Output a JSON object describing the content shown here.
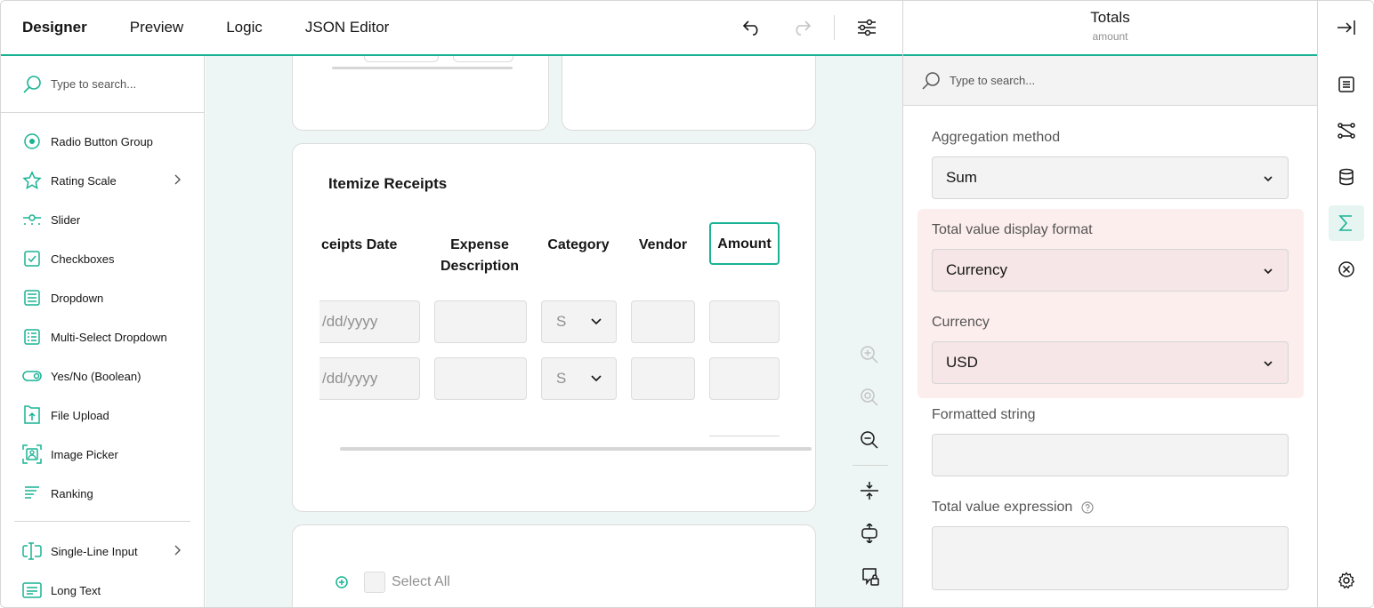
{
  "tabs": [
    "Designer",
    "Preview",
    "Logic",
    "JSON Editor"
  ],
  "toolbox": {
    "search_placeholder": "Type to search...",
    "items": [
      {
        "label": "Radio Button Group",
        "icon": "radio-icon"
      },
      {
        "label": "Rating Scale",
        "icon": "star-icon",
        "has_submenu": true
      },
      {
        "label": "Slider",
        "icon": "slider-icon"
      },
      {
        "label": "Checkboxes",
        "icon": "checkbox-icon"
      },
      {
        "label": "Dropdown",
        "icon": "dropdown-icon"
      },
      {
        "label": "Multi-Select Dropdown",
        "icon": "multiselect-icon"
      },
      {
        "label": "Yes/No (Boolean)",
        "icon": "toggle-icon"
      },
      {
        "label": "File Upload",
        "icon": "file-upload-icon"
      },
      {
        "label": "Image Picker",
        "icon": "image-picker-icon"
      },
      {
        "label": "Ranking",
        "icon": "ranking-icon"
      }
    ],
    "items2": [
      {
        "label": "Single-Line Input",
        "icon": "text-input-icon",
        "has_submenu": true
      },
      {
        "label": "Long Text",
        "icon": "long-text-icon"
      }
    ]
  },
  "matrix": {
    "title": "Itemize Receipts",
    "columns": [
      "ceipts Date",
      "Expense Description",
      "Category",
      "Vendor",
      "Amount"
    ],
    "rows": [
      {
        "date": "/dd/yyyy",
        "category": "S"
      },
      {
        "date": "/dd/yyyy",
        "category": "S"
      }
    ]
  },
  "select_all": "Select All",
  "props": {
    "title": "Totals",
    "subtitle": "amount",
    "search_placeholder": "Type to search...",
    "aggregation_label": "Aggregation method",
    "aggregation_value": "Sum",
    "display_format_label": "Total value display format",
    "display_format_value": "Currency",
    "currency_label": "Currency",
    "currency_value": "USD",
    "formatted_string_label": "Formatted string",
    "formatted_string_value": "",
    "expression_label": "Total value expression",
    "expression_value": ""
  },
  "colors": {
    "accent": "#19b394",
    "highlight": "#fdeeee"
  }
}
